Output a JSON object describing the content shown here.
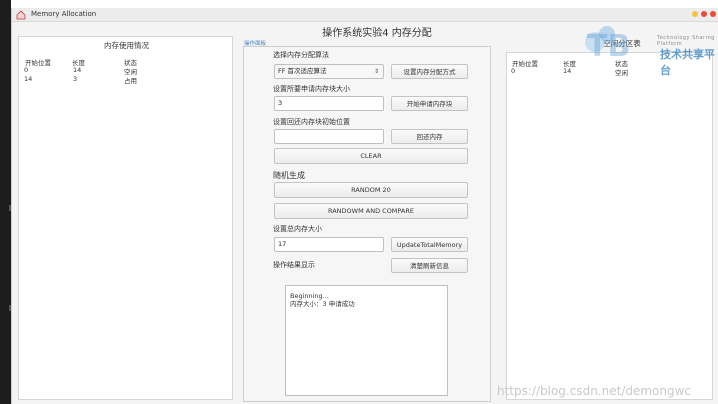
{
  "window": {
    "title": "Memory Allocation",
    "traffic_colors": [
      "#f5c242",
      "#e94b3c",
      "#e94b3c"
    ]
  },
  "main_title": "操作系统实验4 内存分配",
  "left_panel": {
    "title": "内存使用情况",
    "headers": [
      "开始位置",
      "长度",
      "状态"
    ],
    "rows": [
      [
        "0",
        "14",
        "空闲"
      ],
      [
        "14",
        "3",
        "占用"
      ]
    ]
  },
  "right_panel": {
    "title": "空闲分区表",
    "headers": [
      "开始位置",
      "长度",
      "状态"
    ],
    "rows": [
      [
        "0",
        "14",
        "空闲"
      ]
    ]
  },
  "ops": {
    "tag": "操作面板",
    "algo_label": "选择内存分配算法",
    "algo_value": "FF 首次适应算法",
    "set_algo_button": "设置内存分配方式",
    "size_label": "设置所要申请内存块大小",
    "size_value": "3",
    "alloc_button": "开始申请内存块",
    "reclaim_label": "设置回还内存块初始位置",
    "reclaim_value": "",
    "reclaim_button": "回还内存",
    "clear_button": "CLEAR",
    "random_label": "随机生成",
    "random_button": "RANDOM 20",
    "random_compare_button": "RANDOWM AND COMPARE",
    "total_label": "设置总内存大小",
    "total_value": "17",
    "total_button": "UpdateTotalMemory",
    "result_label": "操作结果显示",
    "clear_info_button": "清楚刷新信息",
    "result_lines": [
      "Beginning...",
      "内存大小：3  申请成功"
    ]
  },
  "watermark": {
    "url": "https://blog.csdn.net/demongwc",
    "brand": "技术共享平台",
    "brand_sub": "Technology Sharing Platform",
    "accent": "#2f7fc1"
  }
}
